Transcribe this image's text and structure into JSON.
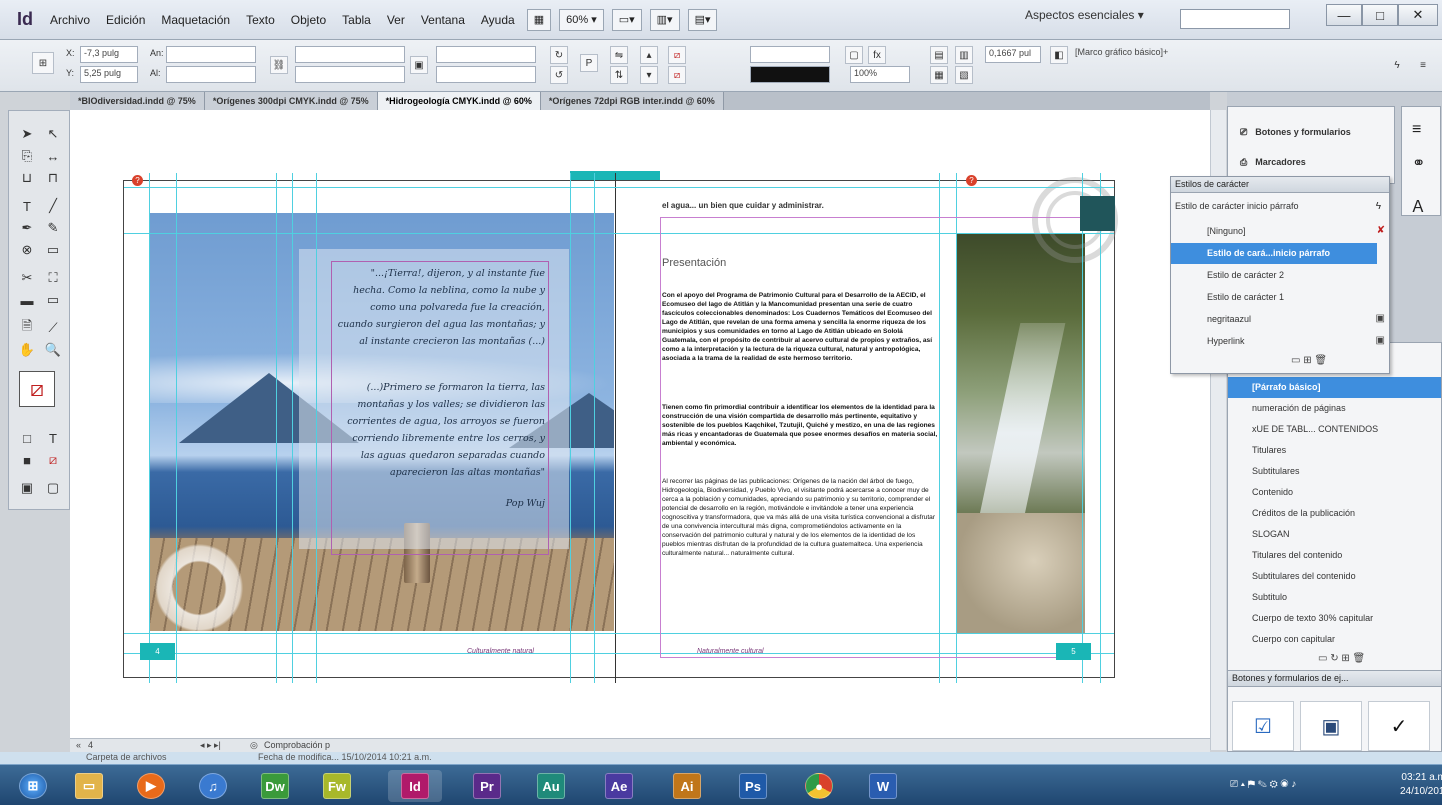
{
  "menubar": {
    "logo": "Id",
    "items": [
      "Archivo",
      "Edición",
      "Maquetación",
      "Texto",
      "Objeto",
      "Tabla",
      "Ver",
      "Ventana",
      "Ayuda"
    ],
    "zoom": "60%",
    "workspace": "Aspectos esenciales",
    "win_min": "—",
    "win_max": "□",
    "win_close": "✕"
  },
  "control": {
    "x_label": "X:",
    "x_value": "-7,3 pulg",
    "y_label": "Y:",
    "y_value": "5,25 pulg",
    "w_label": "An:",
    "h_label": "Al:",
    "stroke_value": "0,1667 pul",
    "frame_style": "[Marco gráfico básico]+",
    "pct": "100%"
  },
  "tabs": [
    {
      "label": "*BIOdiversidad.indd @ 75%"
    },
    {
      "label": "*Orígenes 300dpi CMYK.indd @ 75%"
    },
    {
      "label": "*Hidrogeología CMYK.indd @ 60%",
      "active": true
    },
    {
      "label": "*Orígenes 72dpi RGB inter.indd @ 60%"
    }
  ],
  "spread": {
    "left_quote_1": "\"...¡Tierra!, dijeron, y al instante fue hecha. Como la neblina, como la nube y como una polvareda fue la creación, cuando surgieron del agua las montañas; y al instante crecieron las montañas (...)",
    "left_quote_2": "(...)Primero se formaron la tierra, las montañas y los valles; se dividieron las corrientes de agua, los arroyos se fueron corriendo libremente entre los cerros, y las aguas quedaron separadas cuando aparecieron las altas montañas\"",
    "left_quote_source": "Pop Wuj",
    "right_head": "el agua... un bien que cuidar y administrar.",
    "right_title": "Presentación",
    "para_1": "Con el apoyo del Programa de Patrimonio Cultural para el Desarrollo de la AECID, el Ecomuseo del lago de Atitlán y la Mancomunidad presentan una serie de cuatro fascículos coleccionables denominados: Los Cuadernos Temáticos del Ecomuseo del Lago de Atitlán, que revelan de una forma amena y sencilla la enorme riqueza de los municipios y sus comunidades en torno al Lago de Atitlán ubicado en Sololá Guatemala, con el propósito de contribuir al acervo cultural de propios y extraños, así como a la interpretación y la lectura de la riqueza cultural, natural y antropológica, asociada a la trama de la realidad de este hermoso territorio.",
    "para_2": "Tienen como fin primordial contribuir a identificar los elementos de la identidad para la construcción de una visión compartida de desarrollo más pertinente, equitativo y sostenible de los pueblos Kaqchikel, Tzutujil, Quiché y mestizo, en una de las regiones más ricas y encantadoras de Guatemala que posee enormes desafíos en materia social, ambiental y económica.",
    "para_3": "Al recorrer las páginas de las publicaciones: Orígenes de la nación del árbol de fuego, Hidrogeología, Biodiversidad, y Pueblo Vivo, el visitante podrá acercarse a conocer muy de cerca a la población y comunidades, apreciando su patrimonio y su territorio, comprender el potencial de desarrollo en la región, motivándole e invitándole a tener una experiencia cognoscitiva y transformadora, que va más allá de una visita turística convencional a disfrutar de una convivencia intercultural más digna, comprometiéndolos activamente en la conservación del patrimonio cultural y natural y de los elementos de la identidad de los pueblos mientras disfrutan de la profundidad de la cultura guatemalteca. Una experiencia culturalmente natural... naturalmente cultural.",
    "footer_left": "Culturalmente natural",
    "footer_right": "Naturalmente cultural",
    "page_left": "4",
    "page_right": "5"
  },
  "docstatus": {
    "page": "4",
    "preflight": "Comprobación p"
  },
  "right_panels": {
    "buttons_forms": "Botones y formularios",
    "bookmarks": "Marcadores"
  },
  "char_styles": {
    "title": "Estilos de carácter",
    "current": "Estilo de carácter inicio párrafo",
    "items": [
      {
        "label": "[Ninguno]"
      },
      {
        "label": "Estilo de cará...inicio párrafo",
        "selected": true
      },
      {
        "label": "Estilo de carácter 2"
      },
      {
        "label": "Estilo de carácter 1"
      },
      {
        "label": "negritaazul"
      },
      {
        "label": "Hyperlink"
      }
    ]
  },
  "para_styles": {
    "items": [
      {
        "label": "[Párrafo básico]",
        "selected": true
      },
      {
        "label": "numeración de páginas"
      },
      {
        "label": "xUE DE TABL... CONTENIDOS"
      },
      {
        "label": "Titulares"
      },
      {
        "label": "Subtitulares"
      },
      {
        "label": "Contenido"
      },
      {
        "label": "Créditos de la publicación"
      },
      {
        "label": "SLOGAN"
      },
      {
        "label": "Titulares del contenido"
      },
      {
        "label": "Subtitulares del contenido"
      },
      {
        "label": "Subtitulo"
      },
      {
        "label": "Cuerpo de texto 30% capitular"
      },
      {
        "label": "Cuerpo con capitular"
      }
    ]
  },
  "buttons_panel": {
    "title": "Botones y formularios de ej..."
  },
  "folder_strip": {
    "folder": "Carpeta de archivos",
    "modified": "Fecha de modifica... 15/10/2014 10:21 a.m."
  },
  "taskbar": {
    "apps": [
      {
        "name": "Dw",
        "color": "#3a9a3a"
      },
      {
        "name": "Fw",
        "color": "#a8b82a"
      },
      {
        "name": "Id",
        "color": "#b01a6a"
      },
      {
        "name": "Pr",
        "color": "#5a2a8a"
      },
      {
        "name": "Au",
        "color": "#1f8a7a"
      },
      {
        "name": "Ae",
        "color": "#4a3aa0"
      },
      {
        "name": "Ai",
        "color": "#c0761a"
      },
      {
        "name": "Ps",
        "color": "#1f5aa8"
      },
      {
        "name": "W",
        "color": "#2a5db0"
      }
    ],
    "time": "03:21 a.m.",
    "date": "24/10/2014"
  }
}
